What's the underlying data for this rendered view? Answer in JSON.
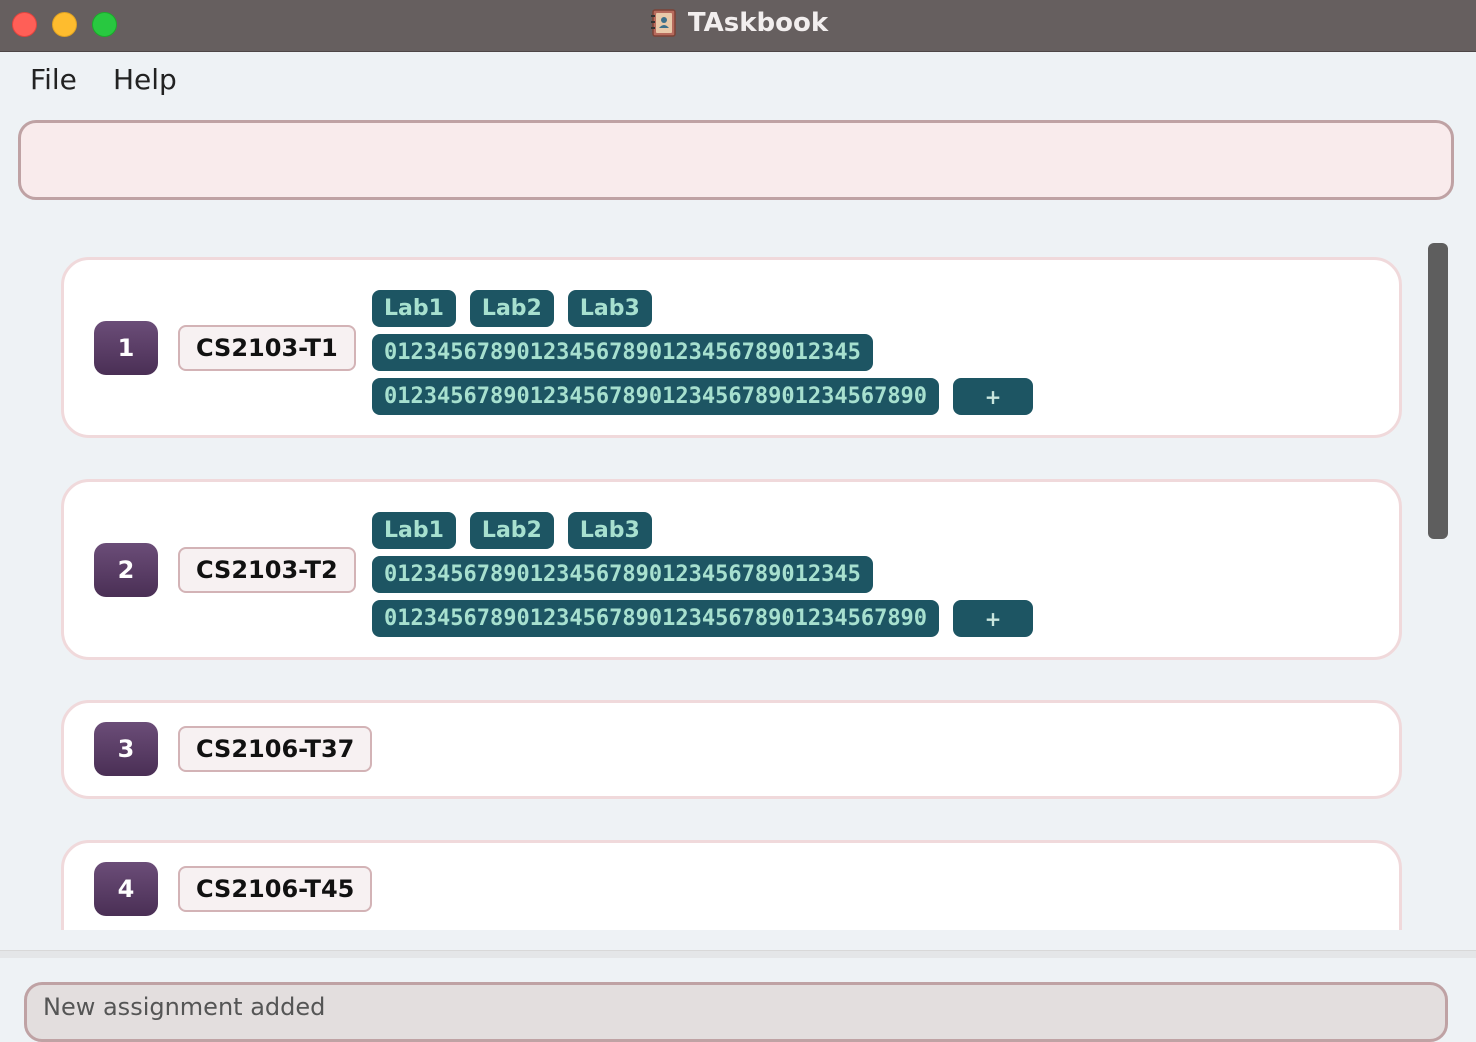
{
  "window": {
    "title": "TAskbook",
    "app_icon": "address-book-icon"
  },
  "menu": {
    "file": "File",
    "help": "Help"
  },
  "command": {
    "value": "",
    "placeholder": ""
  },
  "groups": [
    {
      "index": "1",
      "name": "CS2103-T1",
      "tags_row1": [
        "Lab1",
        "Lab2",
        "Lab3"
      ],
      "tag_long1": "012345678901234567890123456789012345",
      "tag_long2": "0123456789012345678901234567890123456789​0",
      "add_label": "+"
    },
    {
      "index": "2",
      "name": "CS2103-T2",
      "tags_row1": [
        "Lab1",
        "Lab2",
        "Lab3"
      ],
      "tag_long1": "012345678901234567890123456789012345",
      "tag_long2": "01234567890123456789012345678901234567890",
      "add_label": "+"
    },
    {
      "index": "3",
      "name": "CS2106-T37"
    },
    {
      "index": "4",
      "name": "CS2106-T45"
    }
  ],
  "status": {
    "message": "New assignment added"
  },
  "colors": {
    "badge": "#5a3d66",
    "tag_bg": "#1d5563",
    "tag_text": "#a7e0cf",
    "titlebar": "#665f5f"
  }
}
